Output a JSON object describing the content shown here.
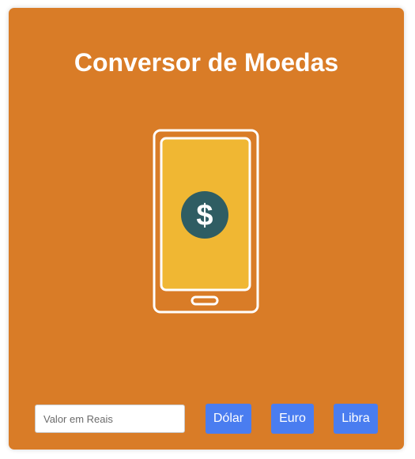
{
  "app": {
    "title": "Conversor de Moedas"
  },
  "converter": {
    "input_placeholder": "Valor em Reais",
    "input_value": "",
    "buttons": [
      {
        "label": "Dólar"
      },
      {
        "label": "Euro"
      },
      {
        "label": "Libra"
      }
    ]
  },
  "illustration": {
    "icon": "phone-with-dollar-icon",
    "symbol": "$"
  },
  "colors": {
    "card_background": "#d97c27",
    "phone_screen": "#f0b733",
    "coin": "#2f5d63",
    "button": "#4a7df0",
    "text": "#ffffff"
  }
}
